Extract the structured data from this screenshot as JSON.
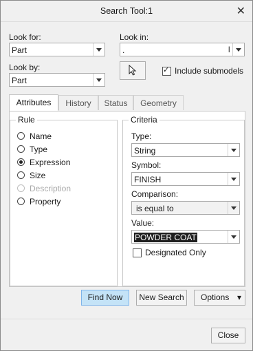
{
  "window": {
    "title": "Search Tool:1"
  },
  "look_for": {
    "label": "Look for:",
    "value": "Part"
  },
  "look_by": {
    "label": "Look by:",
    "value": "Part"
  },
  "look_in": {
    "label": "Look in:",
    "value": "."
  },
  "include_submodels": {
    "label": "Include submodels",
    "checked": true
  },
  "tabs": [
    "Attributes",
    "History",
    "Status",
    "Geometry"
  ],
  "rule": {
    "title": "Rule",
    "options": [
      {
        "label": "Name",
        "selected": false,
        "disabled": false
      },
      {
        "label": "Type",
        "selected": false,
        "disabled": false
      },
      {
        "label": "Expression",
        "selected": true,
        "disabled": false
      },
      {
        "label": "Size",
        "selected": false,
        "disabled": false
      },
      {
        "label": "Description",
        "selected": false,
        "disabled": true
      },
      {
        "label": "Property",
        "selected": false,
        "disabled": false
      }
    ]
  },
  "criteria": {
    "title": "Criteria",
    "type_label": "Type:",
    "type_value": "String",
    "symbol_label": "Symbol:",
    "symbol_value": "FINISH",
    "comparison_label": "Comparison:",
    "comparison_value": "is equal to",
    "value_label": "Value:",
    "value_value": "POWDER COAT",
    "designated_label": "Designated Only",
    "designated_checked": false
  },
  "buttons": {
    "find_now": "Find Now",
    "new_search": "New Search",
    "options": "Options",
    "close": "Close"
  },
  "colors": {
    "primary_button": "#c4e3f7",
    "primary_border": "#7eb4ea"
  }
}
